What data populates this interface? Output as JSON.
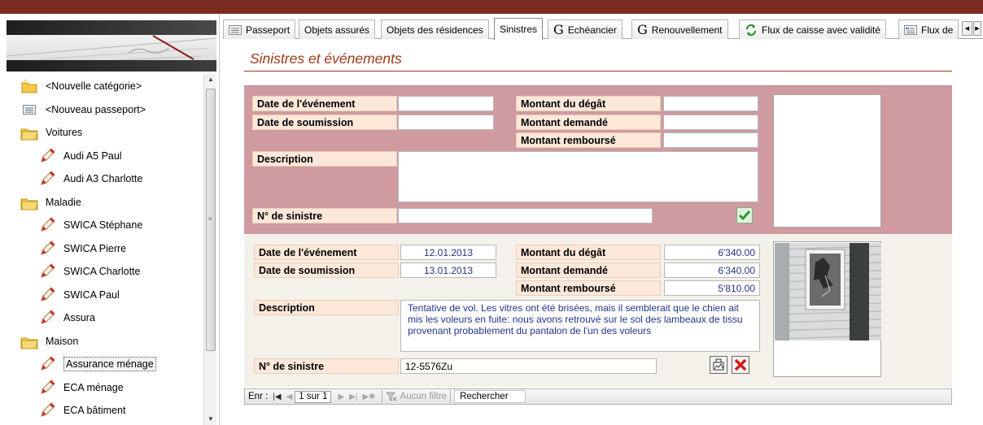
{
  "tabs": [
    {
      "label": "Passeport",
      "icon": "form-icon"
    },
    {
      "label": "Objets assurés",
      "icon": ""
    },
    {
      "label": "Objets des résidences",
      "icon": ""
    },
    {
      "label": "Sinistres",
      "icon": "",
      "active": true
    },
    {
      "label": "Echéancier",
      "icon": "g-icon"
    },
    {
      "label": "Renouvellement",
      "icon": "g-icon"
    },
    {
      "label": "Flux de caisse avec validité",
      "icon": "refresh-icon"
    },
    {
      "label": "Flux de",
      "icon": "form-icon"
    }
  ],
  "page_title": "Sinistres et événements",
  "tree": [
    {
      "label": "<Nouvelle catégorie>",
      "icon": "new-folder-icon",
      "level": 0
    },
    {
      "label": "<Nouveau passeport>",
      "icon": "form-icon",
      "level": 0
    },
    {
      "label": "Voitures",
      "icon": "folder-icon",
      "level": 0
    },
    {
      "label": "Audi A5 Paul",
      "icon": "pencil-icon",
      "level": 1
    },
    {
      "label": "Audi A3 Charlotte",
      "icon": "pencil-icon",
      "level": 1
    },
    {
      "label": "Maladie",
      "icon": "folder-icon",
      "level": 0
    },
    {
      "label": "SWICA Stéphane",
      "icon": "pencil-icon",
      "level": 1
    },
    {
      "label": "SWICA Pierre",
      "icon": "pencil-icon",
      "level": 1
    },
    {
      "label": "SWICA Charlotte",
      "icon": "pencil-icon",
      "level": 1
    },
    {
      "label": "SWICA Paul",
      "icon": "pencil-icon",
      "level": 1
    },
    {
      "label": "Assura",
      "icon": "pencil-icon",
      "level": 1
    },
    {
      "label": "Maison",
      "icon": "folder-icon",
      "level": 0
    },
    {
      "label": "Assurance ménage",
      "icon": "pencil-icon",
      "level": 1,
      "selected": true
    },
    {
      "label": "ECA ménage",
      "icon": "pencil-icon",
      "level": 1
    },
    {
      "label": "ECA bâtiment",
      "icon": "pencil-icon",
      "level": 1
    }
  ],
  "labels": {
    "date_event": "Date de l'événement",
    "date_submission": "Date de soumission",
    "description": "Description",
    "claim_no": "N° de sinistre",
    "damage_amount": "Montant du dégât",
    "requested_amount": "Montant demandé",
    "reimbursed_amount": "Montant remboursé"
  },
  "new_record": {
    "date_event": "",
    "date_submission": "",
    "damage_amount": "",
    "requested_amount": "",
    "reimbursed_amount": "",
    "description": "",
    "claim_no": ""
  },
  "record": {
    "date_event": "12.01.2013",
    "date_submission": "13.01.2013",
    "damage_amount": "6'340.00",
    "requested_amount": "6'340.00",
    "reimbursed_amount": "5'810.00",
    "description": "Tentative de vol. Les vitres ont été brisées, mais il semblerait que le chien ait mis les voleurs en fuite: nous avons retrouvé sur le sol des lambeaux de tissu provenant probablement du pantalon de l'un des voleurs",
    "claim_no": "12-5576Zu"
  },
  "record_nav": {
    "prefix": "Enr :",
    "current": "1 sur 1",
    "filter": "Aucun filtre",
    "search": "Rechercher"
  },
  "colors": {
    "accent": "#a13a1c",
    "top_bar": "#7a2b22",
    "new_form_bg": "#cf9aa0",
    "record_form_bg": "#f4f1ea",
    "label_bg": "#fbe8d9"
  }
}
